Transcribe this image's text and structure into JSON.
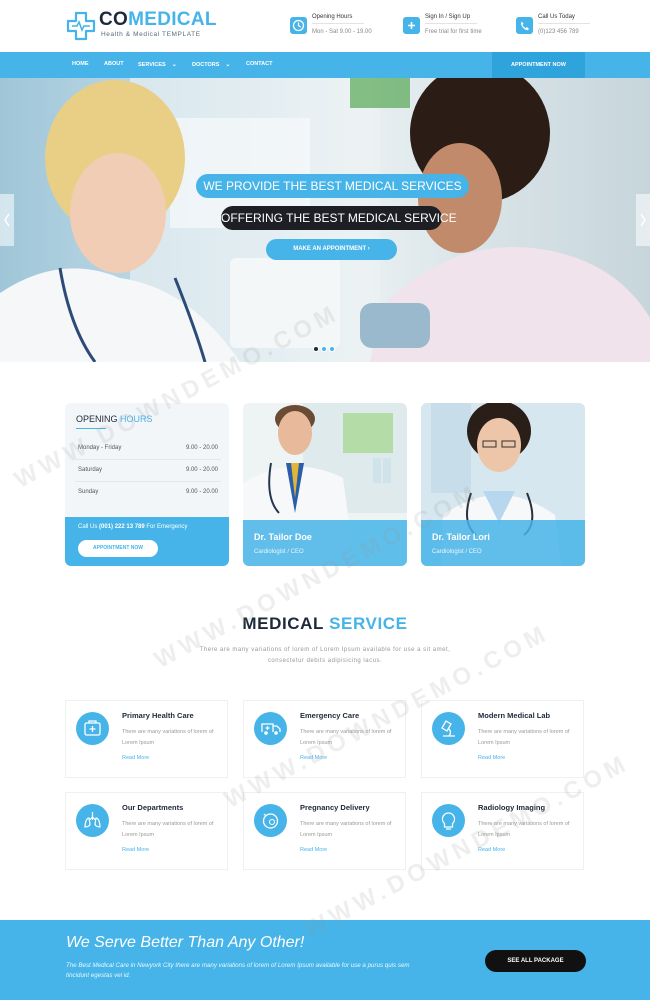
{
  "brand": {
    "name_part1": "CO",
    "name_part2": "MEDICAL",
    "tagline": "Health & Medical TEMPLATE"
  },
  "header_info": [
    {
      "icon": "clock-icon",
      "title": "Opening Hours",
      "detail": "Mon - Sat 9.00 - 19.00"
    },
    {
      "icon": "user-icon",
      "title": "Sign In / Sign Up",
      "detail": "Free trial for first time"
    },
    {
      "icon": "phone-icon",
      "title": "Call Us Today",
      "detail": "(0)123 456 789"
    }
  ],
  "nav": {
    "items": [
      "HOME",
      "ABOUT",
      "SERVICES",
      "DOCTORS",
      "CONTACT"
    ],
    "appointment_label": "APPOINTMENT NOW"
  },
  "hero": {
    "line1": "WE PROVIDE THE BEST MEDICAL SERVICES",
    "line2": "OFFERING THE BEST MEDICAL SERVICE",
    "button": "MAKE AN APPOINTMENT",
    "active_slide": 1,
    "slide_count": 3
  },
  "hours": {
    "title_part1": "OPENING",
    "title_part2": "HOURS",
    "rows": [
      {
        "day": "Monday - Friday",
        "time": "9.00 - 20.00"
      },
      {
        "day": "Saturday",
        "time": "9.00 - 20.00"
      },
      {
        "day": "Sunday",
        "time": "9.00 - 20.00"
      }
    ],
    "call_prefix": "Call Us",
    "call_number": "(001) 222 13 789",
    "call_suffix": "For Emergency",
    "button": "APPOINTMENT NOW"
  },
  "doctors": [
    {
      "name": "Dr. Tailor Doe",
      "role": "Cardiologist / CEO"
    },
    {
      "name": "Dr. Tailor Lori",
      "role": "Cardiologist / CEO"
    }
  ],
  "services_section": {
    "title_part1": "MEDICAL",
    "title_part2": "SERVICE",
    "description": "There are many variations of lorem of Lorem Ipsum available for use a sit amet, consectetur debits adipisicing lacus."
  },
  "services": [
    {
      "icon": "first-aid-kit-icon",
      "title": "Primary Health Care",
      "desc": "There are many variations of lorem of Lorem Ipsum",
      "more": "Read More"
    },
    {
      "icon": "ambulance-icon",
      "title": "Emergency Care",
      "desc": "There are many variations of lorem of Lorem Ipsum",
      "more": "Read More"
    },
    {
      "icon": "microscope-icon",
      "title": "Modern Medical Lab",
      "desc": "There are many variations of lorem of Lorem Ipsum",
      "more": "Read More"
    },
    {
      "icon": "lungs-icon",
      "title": "Our Departments",
      "desc": "There are many variations of lorem of Lorem Ipsum",
      "more": "Read More"
    },
    {
      "icon": "pregnancy-icon",
      "title": "Pregnancy Delivery",
      "desc": "There are many variations of lorem of Lorem Ipsum",
      "more": "Read More"
    },
    {
      "icon": "radiology-icon",
      "title": "Radiology Imaging",
      "desc": "There are many variations of lorem of Lorem Ipsum",
      "more": "Read More"
    }
  ],
  "banner": {
    "title": "We Serve Better Than Any Other!",
    "description": "The Best Medical Care in Newyork City there are many variations of lorem of Lorem Ipsum available for use a purus quis sem tincidunt egestas vel id.",
    "button": "SEE ALL PACKAGE"
  },
  "watermark": "WWW.DOWNDEMO.COM",
  "colors": {
    "accent": "#46b4e8",
    "dark": "#1d2a3a"
  }
}
